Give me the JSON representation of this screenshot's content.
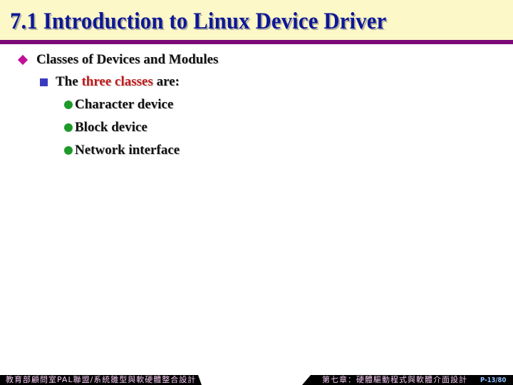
{
  "slide": {
    "title": "7.1 Introduction to Linux Device Driver",
    "level1": {
      "text": "Classes of Devices and Modules"
    },
    "level2": {
      "prefix": "The ",
      "highlight": "three classes",
      "suffix": " are:"
    },
    "level3": [
      {
        "text": "Character device"
      },
      {
        "text": "Block device"
      },
      {
        "text": "Network interface"
      }
    ]
  },
  "footer": {
    "left_text": "教育部顧問室PAL聯盟/系統雛型與軟硬體整合設計",
    "right_text": "第七章：硬體驅動程式與軟體介面設計",
    "page_label": "P-13/80"
  },
  "colors": {
    "title": "#0c1796",
    "title_band": "#fdf8c8",
    "rule": "#7a0a78",
    "highlight": "#c41a1a",
    "bullet_l1": "#c0109a",
    "bullet_l2": "#3a3ac0",
    "bullet_l3": "#1e9a2a"
  }
}
